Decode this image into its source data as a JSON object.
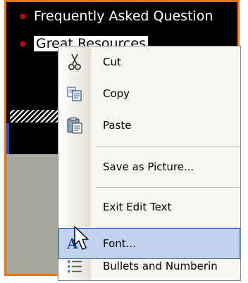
{
  "document": {
    "line1": "Frequently Asked Question",
    "line2": "Great Resources"
  },
  "context_menu": {
    "items": [
      {
        "label": "Cut",
        "icon": "scissors-icon"
      },
      {
        "label": "Copy",
        "icon": "copy-icon"
      },
      {
        "label": "Paste",
        "icon": "paste-icon"
      },
      {
        "label": "Save as Picture...",
        "icon": ""
      },
      {
        "label": "Exit Edit Text",
        "icon": ""
      },
      {
        "label": "Font...",
        "icon": "font-icon"
      },
      {
        "label": "Bullets and Numberin",
        "icon": "bullets-icon"
      }
    ],
    "highlighted": "Font..."
  },
  "colors": {
    "frame": "#f0750a",
    "highlight": "#c1d2ee",
    "highlight_border": "#316ac5",
    "bullet": "#b3001b"
  }
}
